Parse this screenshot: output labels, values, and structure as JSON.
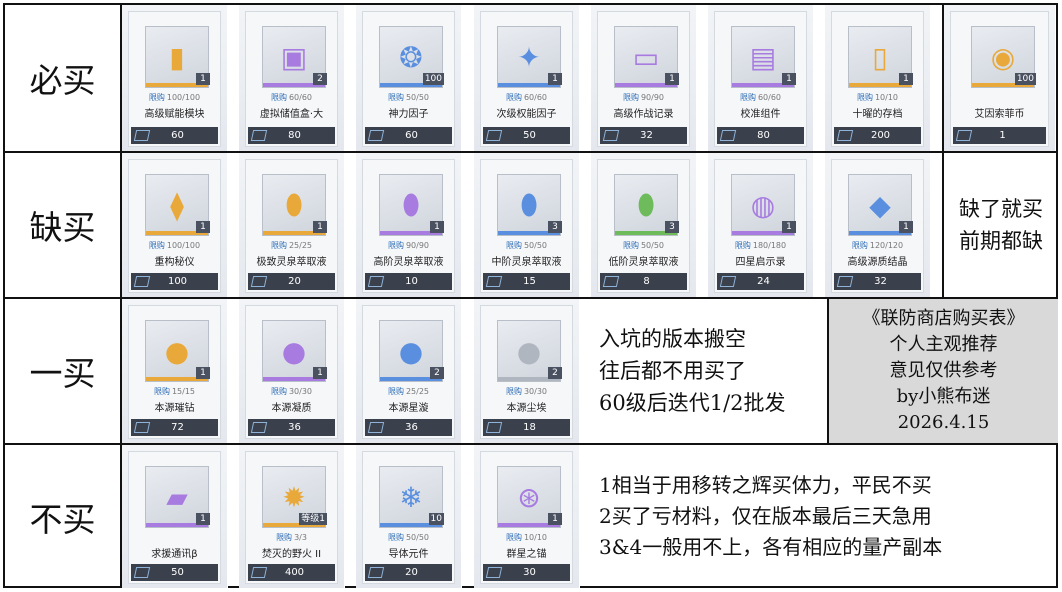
{
  "colors": {
    "gold": "#e8a93a",
    "purple": "#a77be0",
    "blue": "#5a8fe0",
    "green": "#6dbb5a",
    "grey": "#b0b6c0"
  },
  "rows": [
    {
      "label": "必买",
      "items": [
        {
          "name": "高级赋能模块",
          "limit": "100/100",
          "qty": "1",
          "price": "60",
          "icon": "module-icon",
          "rarity": "gold"
        },
        {
          "name": "虚拟储值盒·大",
          "limit": "60/60",
          "qty": "2",
          "price": "80",
          "icon": "treasure-box-icon",
          "rarity": "purple"
        },
        {
          "name": "神力因子",
          "limit": "50/50",
          "qty": "100",
          "price": "60",
          "icon": "factor-icon",
          "rarity": "blue"
        },
        {
          "name": "次级权能因子",
          "limit": "60/60",
          "qty": "1",
          "price": "50",
          "icon": "crystal-icon",
          "rarity": "blue"
        },
        {
          "name": "高级作战记录",
          "limit": "90/90",
          "qty": "1",
          "price": "32",
          "icon": "exp-card-icon",
          "rarity": "purple"
        },
        {
          "name": "校准组件",
          "limit": "60/60",
          "qty": "1",
          "price": "80",
          "icon": "toolbox-icon",
          "rarity": "purple"
        },
        {
          "name": "十曜的存档",
          "limit": "10/10",
          "qty": "1",
          "price": "200",
          "icon": "document-icon",
          "rarity": "gold"
        },
        {
          "name": "艾因索菲币",
          "limit": "",
          "qty": "100",
          "price": "1",
          "icon": "coin-icon",
          "rarity": "gold"
        }
      ]
    },
    {
      "label": "缺买",
      "items": [
        {
          "name": "重构秘仪",
          "limit": "100/100",
          "qty": "1",
          "price": "100",
          "icon": "device-icon",
          "rarity": "gold"
        },
        {
          "name": "极致灵泉萃取液",
          "limit": "25/25",
          "qty": "1",
          "price": "20",
          "icon": "vial-icon",
          "rarity": "gold"
        },
        {
          "name": "高阶灵泉萃取液",
          "limit": "90/90",
          "qty": "1",
          "price": "10",
          "icon": "vial-icon",
          "rarity": "purple"
        },
        {
          "name": "中阶灵泉萃取液",
          "limit": "50/50",
          "qty": "3",
          "price": "15",
          "icon": "vial-icon",
          "rarity": "blue"
        },
        {
          "name": "低阶灵泉萃取液",
          "limit": "50/50",
          "qty": "3",
          "price": "8",
          "icon": "vial-icon",
          "rarity": "green"
        },
        {
          "name": "四星启示录",
          "limit": "180/180",
          "qty": "1",
          "price": "24",
          "icon": "portrait-icon",
          "rarity": "purple"
        },
        {
          "name": "高级源质结晶",
          "limit": "120/120",
          "qty": "1",
          "price": "32",
          "icon": "cube-icon",
          "rarity": "blue"
        }
      ],
      "note": [
        "缺了就买",
        "前期都缺"
      ]
    },
    {
      "label": "一买",
      "items": [
        {
          "name": "本源璀钻",
          "limit": "15/15",
          "qty": "1",
          "price": "72",
          "icon": "orb-icon",
          "rarity": "gold"
        },
        {
          "name": "本源凝质",
          "limit": "30/30",
          "qty": "1",
          "price": "36",
          "icon": "orb-icon",
          "rarity": "purple"
        },
        {
          "name": "本源星漩",
          "limit": "25/25",
          "qty": "2",
          "price": "36",
          "icon": "orb-icon",
          "rarity": "blue"
        },
        {
          "name": "本源尘埃",
          "limit": "30/30",
          "qty": "2",
          "price": "18",
          "icon": "orb-icon",
          "rarity": "grey"
        }
      ],
      "note": [
        "入坑的版本搬空",
        "往后都不用买了",
        "60级后迭代1/2批发"
      ],
      "signature": [
        "《联防商店购买表》",
        "个人主观推荐",
        "意见仅供参考",
        "by小熊布迷",
        "2026.4.15"
      ]
    },
    {
      "label": "不买",
      "items": [
        {
          "name": "求援通讯β",
          "limit": "",
          "qty": "1",
          "price": "50",
          "icon": "phone-icon",
          "rarity": "purple"
        },
        {
          "name": "焚灭的野火 II",
          "limit": "3/3",
          "qty": "等级1",
          "price": "400",
          "icon": "emblem-icon",
          "rarity": "gold"
        },
        {
          "name": "导体元件",
          "limit": "50/50",
          "qty": "10",
          "price": "20",
          "icon": "snowflake-icon",
          "rarity": "blue"
        },
        {
          "name": "群星之锚",
          "limit": "10/10",
          "qty": "1",
          "price": "30",
          "icon": "gyroscope-icon",
          "rarity": "purple"
        }
      ],
      "note": [
        "1相当于用移转之辉买体力，平民不买",
        "2买了亏材料，仅在版本最后三天急用",
        "3&4一般用不上，各有相应的量产副本"
      ]
    }
  ],
  "limit_prefix": "限购"
}
